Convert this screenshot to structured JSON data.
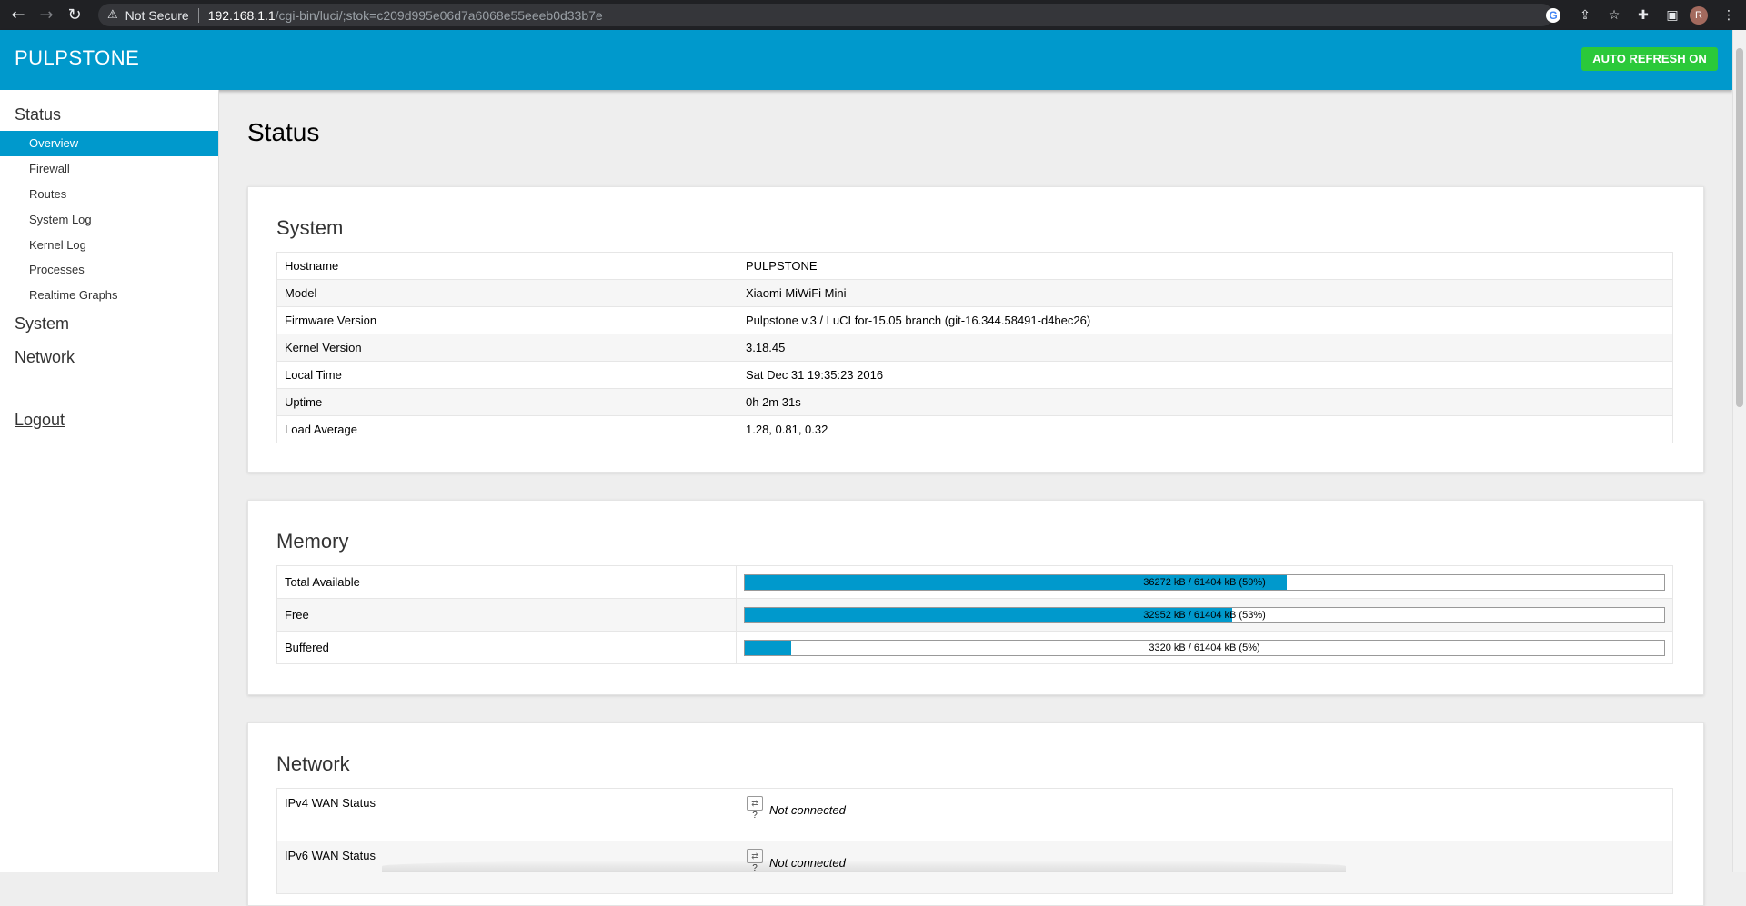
{
  "browser": {
    "security_label": "Not Secure",
    "url_host": "192.168.1.1",
    "url_path": "/cgi-bin/luci/;stok=c209d995e06d7a6068e55eeeb0d33b7e",
    "profile_initial": "R"
  },
  "header": {
    "brand": "PULPSTONE",
    "auto_refresh_label": "AUTO REFRESH ON",
    "accent_color": "#0099cc",
    "refresh_color": "#2bc93a"
  },
  "sidebar": {
    "status_label": "Status",
    "status_items": [
      "Overview",
      "Firewall",
      "Routes",
      "System Log",
      "Kernel Log",
      "Processes",
      "Realtime Graphs"
    ],
    "active_item": "Overview",
    "system_label": "System",
    "network_label": "Network",
    "logout_label": "Logout"
  },
  "main": {
    "page_title": "Status",
    "system": {
      "title": "System",
      "rows": [
        {
          "key": "Hostname",
          "value": "PULPSTONE"
        },
        {
          "key": "Model",
          "value": "Xiaomi MiWiFi Mini"
        },
        {
          "key": "Firmware Version",
          "value": "Pulpstone v.3 / LuCI for-15.05 branch (git-16.344.58491-d4bec26)"
        },
        {
          "key": "Kernel Version",
          "value": "3.18.45"
        },
        {
          "key": "Local Time",
          "value": "Sat Dec 31 19:35:23 2016"
        },
        {
          "key": "Uptime",
          "value": "0h 2m 31s"
        },
        {
          "key": "Load Average",
          "value": "1.28, 0.81, 0.32"
        }
      ]
    },
    "memory": {
      "title": "Memory",
      "rows": [
        {
          "key": "Total Available",
          "text": "36272 kB / 61404 kB (59%)",
          "fraction": 0.59
        },
        {
          "key": "Free",
          "text": "32952 kB / 61404 kB (53%)",
          "fraction": 0.53
        },
        {
          "key": "Buffered",
          "text": "3320 kB / 61404 kB (5%)",
          "fraction": 0.05
        }
      ]
    },
    "network": {
      "title": "Network",
      "rows": [
        {
          "key": "IPv4 WAN Status",
          "icon_caption": "?",
          "status": "Not connected"
        },
        {
          "key": "IPv6 WAN Status",
          "icon_caption": "?",
          "status": "Not connected"
        }
      ]
    }
  }
}
